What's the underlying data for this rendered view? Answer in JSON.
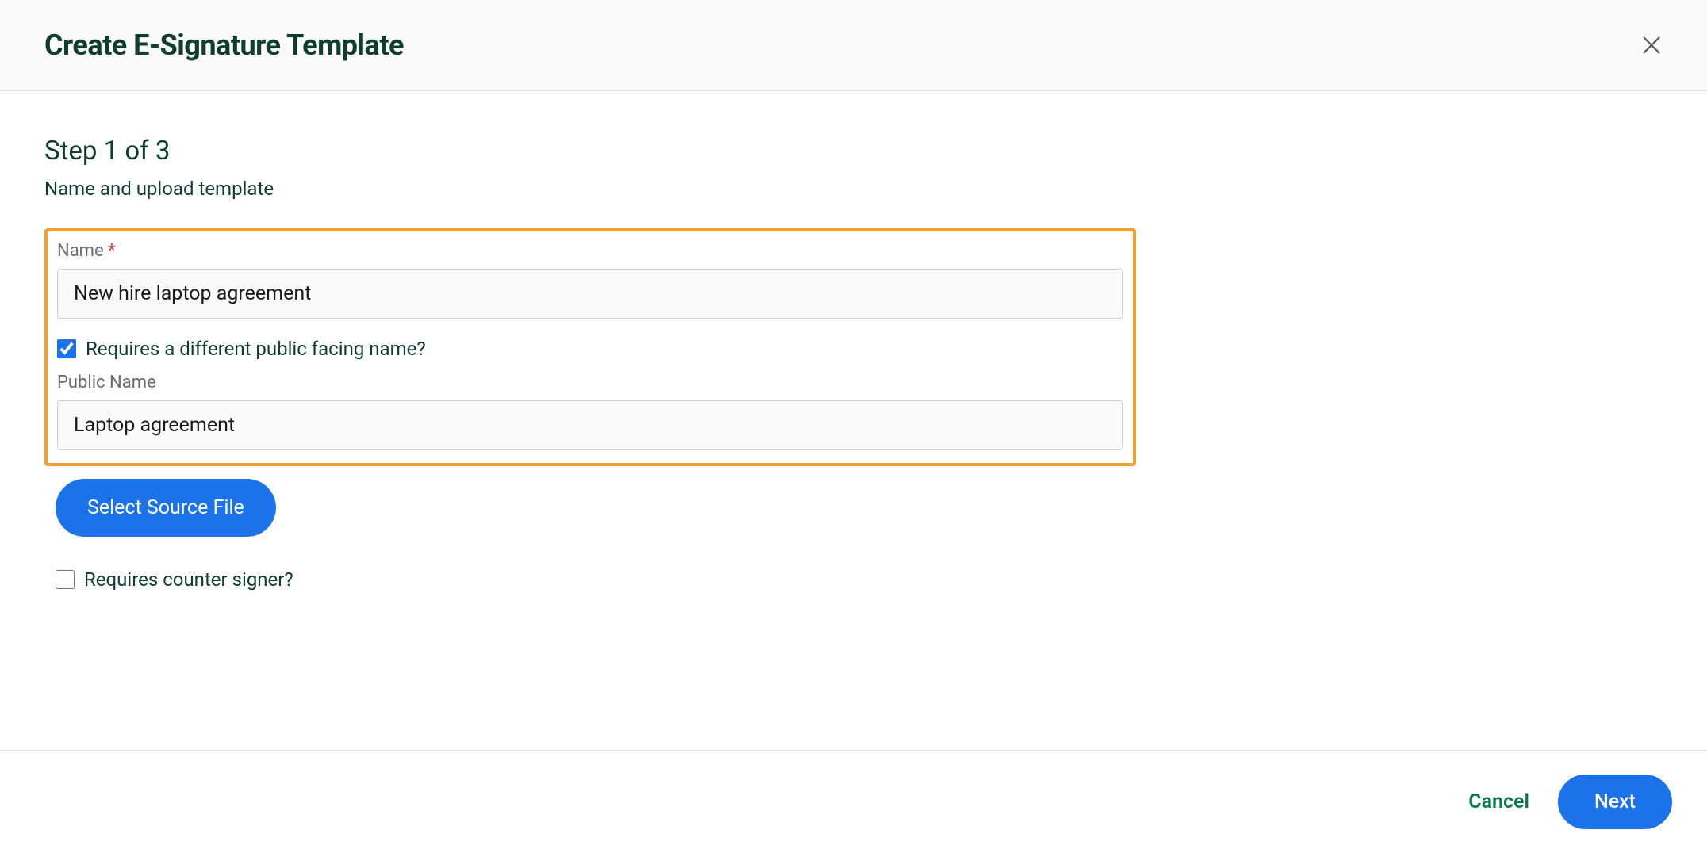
{
  "header": {
    "title": "Create E-Signature Template"
  },
  "step": {
    "title": "Step 1 of 3",
    "subtitle": "Name and upload template"
  },
  "form": {
    "name_label": "Name",
    "name_value": "New hire laptop agreement",
    "public_name_checkbox_label": "Requires a different public facing name?",
    "public_name_checked": true,
    "public_name_label": "Public Name",
    "public_name_value": "Laptop agreement",
    "select_file_label": "Select Source File",
    "counter_signer_label": "Requires counter signer?",
    "counter_signer_checked": false
  },
  "footer": {
    "cancel_label": "Cancel",
    "next_label": "Next"
  }
}
